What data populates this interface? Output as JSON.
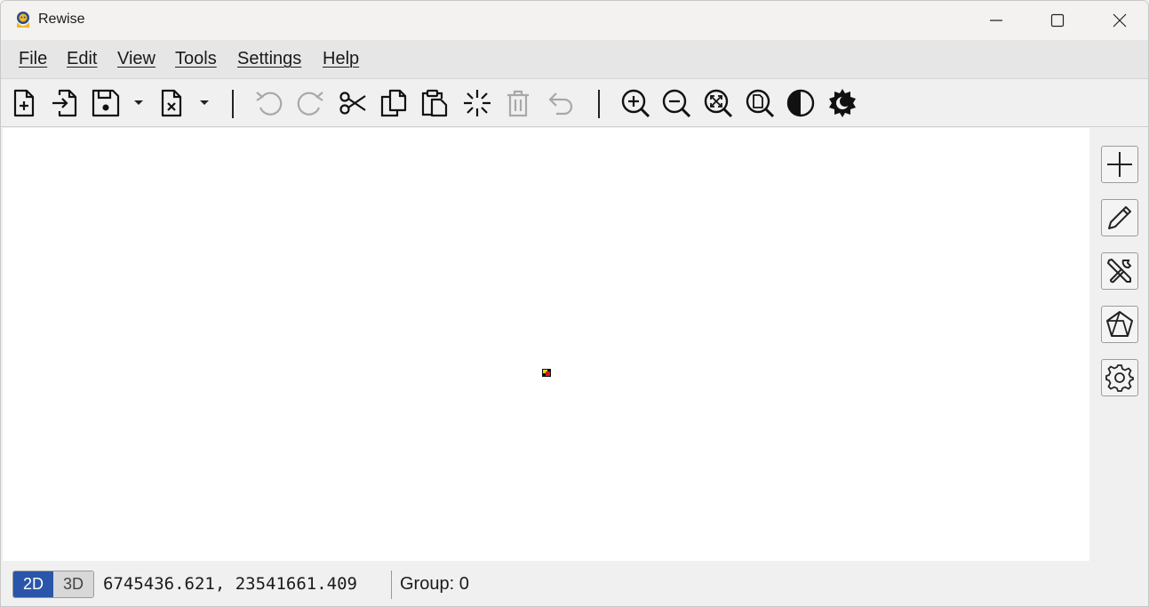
{
  "window": {
    "title": "Rewise"
  },
  "menu": [
    {
      "name": "menu-file",
      "label": "File"
    },
    {
      "name": "menu-edit",
      "label": "Edit"
    },
    {
      "name": "menu-view",
      "label": "View"
    },
    {
      "name": "menu-tools",
      "label": "Tools"
    },
    {
      "name": "menu-settings",
      "label": "Settings"
    },
    {
      "name": "menu-help",
      "label": "Help"
    }
  ],
  "toolbar": {
    "icons": [
      "new-file-icon",
      "import-icon",
      "save-icon",
      "close-file-icon",
      "undo-icon",
      "redo-icon",
      "cut-icon",
      "copy-icon",
      "paste-icon",
      "select-icon",
      "delete-icon",
      "revert-icon",
      "zoom-in-icon",
      "zoom-out-icon",
      "zoom-fit-icon",
      "zoom-page-icon",
      "contrast-icon",
      "theme-icon"
    ]
  },
  "side_panel": {
    "icons": [
      "add-icon",
      "edit-pencil-icon",
      "tools-icon",
      "polygon-icon",
      "settings-gear-icon"
    ]
  },
  "status": {
    "mode_2d": "2D",
    "mode_3d": "3D",
    "active_mode": "2D",
    "coordinates": "6745436.621, 23541661.409",
    "group": "Group: 0"
  },
  "colors": {
    "active_mode": "#2a55a8",
    "canvas": "#ffffff"
  }
}
